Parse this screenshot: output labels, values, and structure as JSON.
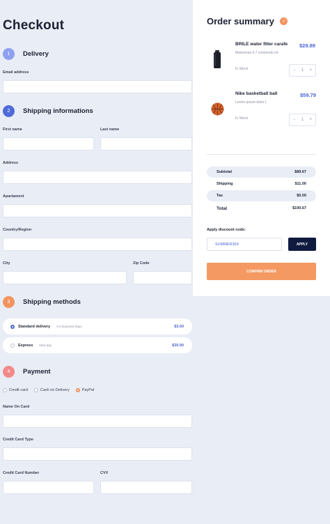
{
  "checkout": {
    "title": "Checkout",
    "delivery": {
      "step": "1",
      "title": "Delivery",
      "email_label": "Email address",
      "email_value": ""
    },
    "shipping_info": {
      "step": "2",
      "title": "Shipping informations",
      "first_name_label": "First name",
      "last_name_label": "Last name",
      "address_label": "Address",
      "apartment_label": "Apartament",
      "country_label": "Country/Region",
      "city_label": "City",
      "zip_label": "Zip Code"
    },
    "shipping_methods": {
      "step": "3",
      "title": "Shipping methods",
      "options": [
        {
          "name": "Standard delivery",
          "sub": "3-4 business days",
          "price": "$3.00",
          "selected": true
        },
        {
          "name": "Express",
          "sub": "Next day",
          "price": "$20.00",
          "selected": false
        }
      ]
    },
    "payment": {
      "step": "4",
      "title": "Payment",
      "methods": [
        {
          "label": "Credit card",
          "selected": false
        },
        {
          "label": "Cash on Delivery",
          "selected": false
        },
        {
          "label": "PayPal",
          "selected": true
        }
      ],
      "name_label": "Name On Card",
      "type_label": "Credit Card Type",
      "number_label": "Credit Card Number",
      "cvv_label": "CVV"
    }
  },
  "summary": {
    "title": "Order summary",
    "count": "2",
    "products": [
      {
        "name": "BRILE water filter carafe",
        "desc": "Maecenas 0.7 commodo sit",
        "price": "$29.89",
        "stock": "In Stock",
        "qty": "1",
        "icon": "bottle-image"
      },
      {
        "name": "Nike basketball ball",
        "desc": "Lorem ipsum dolor L",
        "price": "$59.79",
        "stock": "In Stock",
        "qty": "1",
        "icon": "basketball-image"
      }
    ],
    "subtotal_label": "Subtotal",
    "subtotal_value": "$89.67",
    "shipping_label": "Shipping",
    "shipping_value": "$11.00",
    "tax_label": "Tax",
    "tax_value": "$0.00",
    "total_label": "Total",
    "total_value": "$100.67",
    "discount_label": "Apply discount code:",
    "discount_value": "SUMMER30X",
    "apply_label": "APPLY",
    "confirm_label": "CONFIRM ORDER"
  },
  "colors": {
    "background": "#e9edf5",
    "accent_blue": "#4a64d6",
    "accent_orange": "#f49962",
    "dark_button": "#101a3f",
    "step1": "#8ea0ef",
    "step2": "#4f6bd8",
    "step3": "#f2935e",
    "step4": "#f28a8a"
  }
}
